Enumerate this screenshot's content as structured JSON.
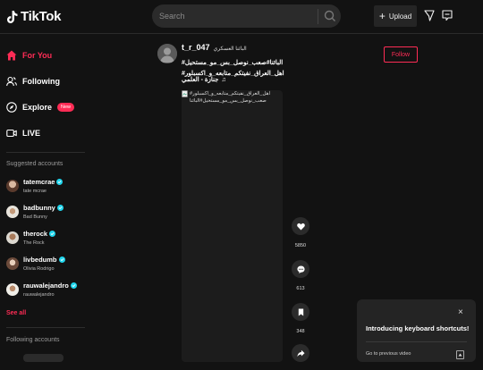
{
  "header": {
    "logo_text": "TikTok",
    "search_placeholder": "Search",
    "upload_label": "Upload"
  },
  "sidebar": {
    "nav": [
      {
        "label": "For You",
        "icon": "home-icon",
        "active": true
      },
      {
        "label": "Following",
        "icon": "users-icon"
      },
      {
        "label": "Explore",
        "icon": "compass-icon",
        "badge": "New"
      },
      {
        "label": "LIVE",
        "icon": "live-icon"
      }
    ],
    "suggested_heading": "Suggested accounts",
    "suggested": [
      {
        "username": "tatemcrae",
        "display": "tate mcrae"
      },
      {
        "username": "badbunny",
        "display": "Bad Bunny"
      },
      {
        "username": "therock",
        "display": "The Rock"
      },
      {
        "username": "livbedumb",
        "display": "Olivia Rodrigo"
      },
      {
        "username": "rauwalejandro",
        "display": "rauwalejandro"
      }
    ],
    "see_all": "See all",
    "following_heading": "Following accounts"
  },
  "post": {
    "username": "t_r_047",
    "display_name": "البائنا العسكري",
    "caption": "البائنا#صعب_نوصل_بس_مو_مستحيل# اهل_العراق_نفيتكم_متابعه_و_اكسبلور#",
    "music": "جنازة - العلمي",
    "follow_label": "Follow",
    "video_alt": "اهل_العراق_نفيتكم_متابعه_و_اكسبلور# صعب_نوصل_بس_مو_مستحيل#البائنا",
    "actions": [
      {
        "icon": "heart-icon",
        "count": "5850"
      },
      {
        "icon": "comment-icon",
        "count": "613"
      },
      {
        "icon": "bookmark-icon",
        "count": "348"
      },
      {
        "icon": "share-icon",
        "count": ""
      }
    ]
  },
  "popup": {
    "title": "Introducing keyboard shortcuts!",
    "row_label": "Go to previous video",
    "close": "×"
  },
  "colors": {
    "accent": "#fe2c55",
    "background": "#121212"
  }
}
